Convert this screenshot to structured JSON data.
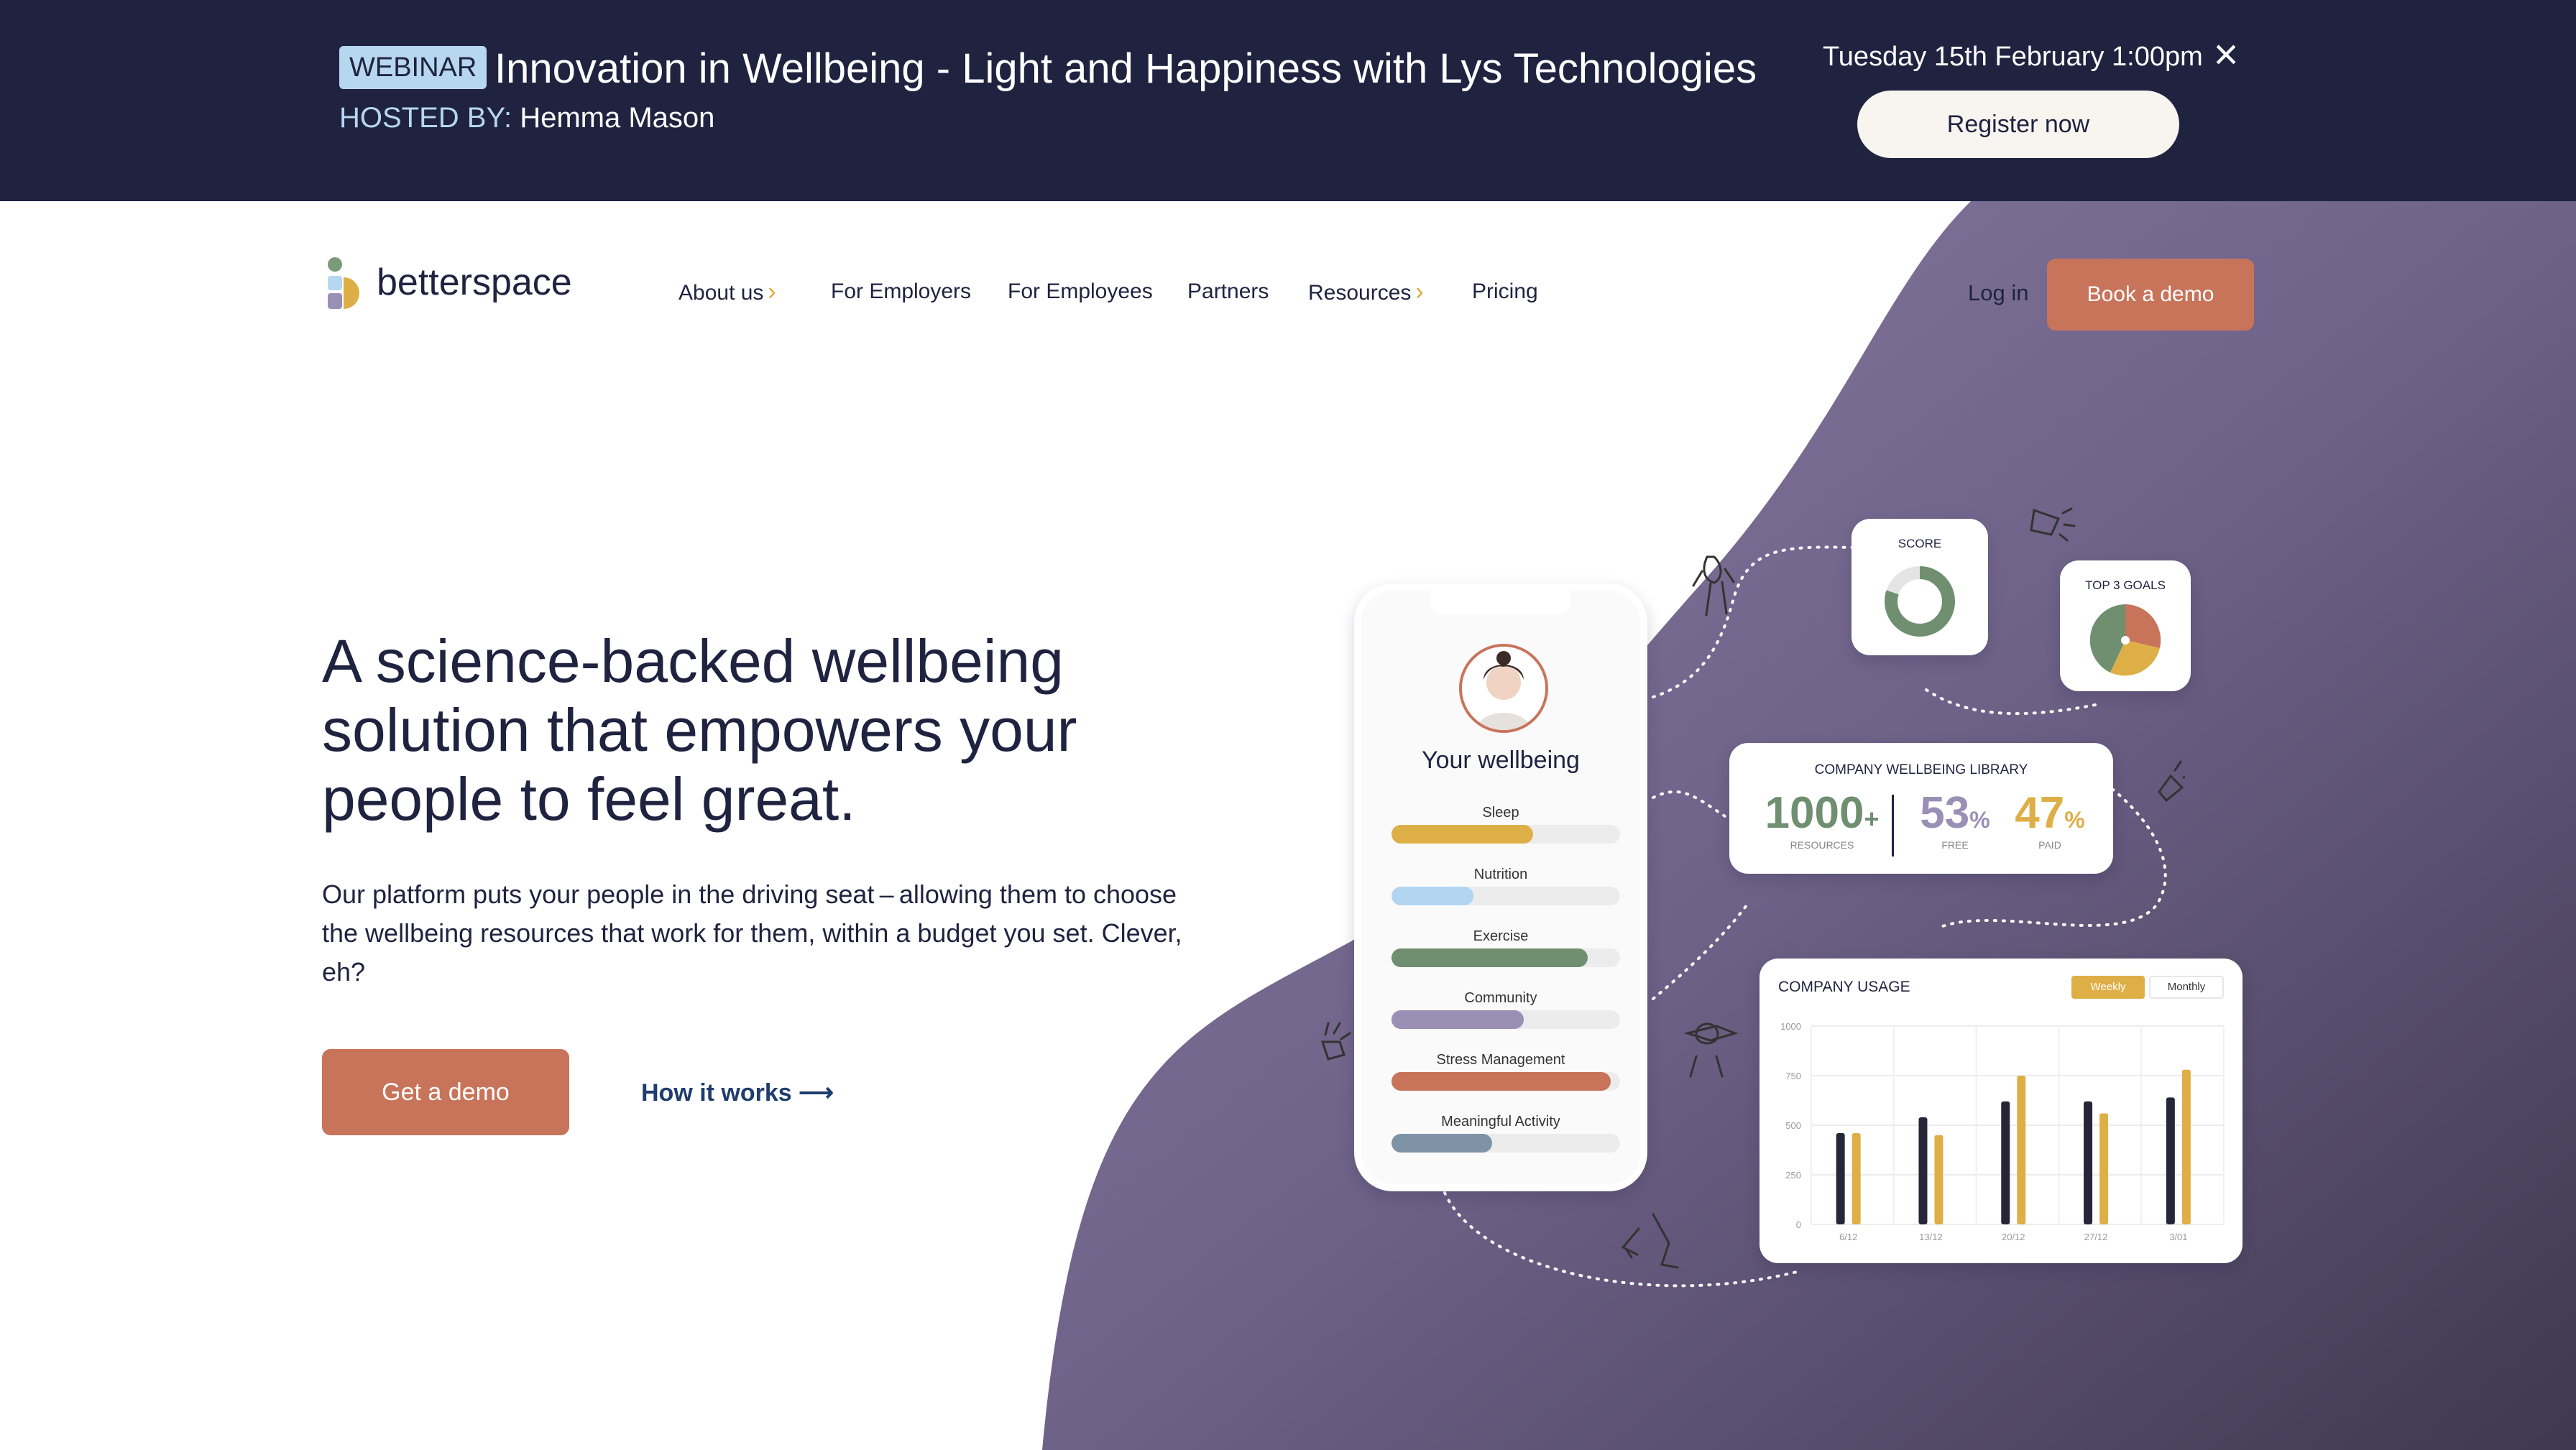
{
  "banner": {
    "badge": "WEBINAR",
    "title": "Innovation in Wellbeing - Light and Happiness with Lys Technologies",
    "hosted_label": "HOSTED BY:",
    "host": "Hemma Mason",
    "date": "Tuesday 15th February 1:00pm",
    "close_icon": "×",
    "register_label": "Register now"
  },
  "nav": {
    "logo_text": "betterspace",
    "items": [
      {
        "label": "About us",
        "has_submenu": true
      },
      {
        "label": "For Employers"
      },
      {
        "label": "For Employees"
      },
      {
        "label": "Partners"
      },
      {
        "label": "Resources",
        "has_submenu": true
      },
      {
        "label": "Pricing"
      }
    ],
    "chevron_icon": "›",
    "login_label": "Log in",
    "book_label": "Book a demo"
  },
  "hero": {
    "title": "A science-backed wellbeing solution that empowers your people to feel great.",
    "subtitle": "Our platform puts your people in the driving seat – allowing them to choose the wellbeing resources that work for them, within a budget you set. Clever, eh?",
    "cta_label": "Get a demo",
    "link_label": "How it works ⟶"
  },
  "phone": {
    "title": "Your wellbeing",
    "metrics": [
      {
        "label": "Sleep",
        "value": 0.62,
        "color": "#deaf47"
      },
      {
        "label": "Nutrition",
        "value": 0.36,
        "color": "#b2d5f0"
      },
      {
        "label": "Exercise",
        "value": 0.86,
        "color": "#6f8f70"
      },
      {
        "label": "Community",
        "value": 0.58,
        "color": "#9a8fb5"
      },
      {
        "label": "Stress Management",
        "value": 0.96,
        "color": "#c8745a"
      },
      {
        "label": "Meaningful Activity",
        "value": 0.44,
        "color": "#7f93a6"
      }
    ]
  },
  "score": {
    "title": "SCORE",
    "value": 0.8
  },
  "goals": {
    "title": "TOP 3 GOALS"
  },
  "library": {
    "title": "COMPANY WELLBEING LIBRARY",
    "resources_value": "1000",
    "resources_suffix": "+",
    "resources_label": "RESOURCES",
    "free_value": "53",
    "free_suffix": "%",
    "free_label": "FREE",
    "paid_value": "47",
    "paid_suffix": "%",
    "paid_label": "PAID",
    "colors": {
      "resources": "#6f8f70",
      "free": "#9a8fb5",
      "paid": "#deaf47"
    }
  },
  "usage": {
    "title": "COMPANY USAGE",
    "toggle": [
      "Weekly",
      "Monthly"
    ],
    "active_toggle": "Weekly"
  },
  "chart_data": {
    "type": "bar",
    "title": "COMPANY USAGE",
    "categories": [
      "6/12",
      "13/12",
      "20/12",
      "27/12",
      "3/01"
    ],
    "series": [
      {
        "color": "#262638",
        "values": [
          460,
          540,
          620,
          620,
          640
        ]
      },
      {
        "color": "#deaf47",
        "values": [
          460,
          450,
          750,
          560,
          780
        ]
      }
    ],
    "yticks": [
      0,
      250,
      500,
      750,
      1000
    ],
    "ylim": [
      0,
      1000
    ],
    "grid": true
  },
  "colors": {
    "banner_bg": "#1f2340",
    "accent": "#c8745a",
    "wave": "#6f6488",
    "badge_bg": "#b7d6ef"
  }
}
